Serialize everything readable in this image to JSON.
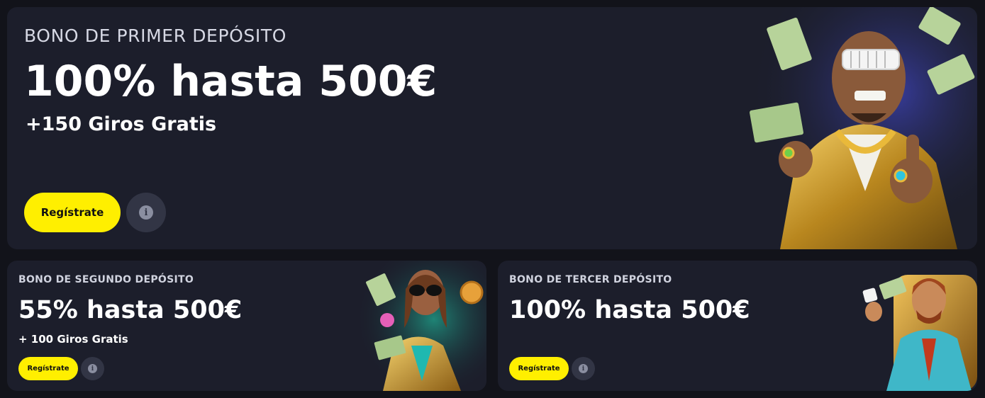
{
  "promos": {
    "first": {
      "kicker": "BONO DE PRIMER DEPÓSITO",
      "headline": "100% hasta 500€",
      "subline": "+150 Giros Gratis",
      "cta_label": "Regístrate",
      "info_icon": "info-icon"
    },
    "second": {
      "kicker": "BONO DE SEGUNDO DEPÓSITO",
      "headline": "55% hasta 500€",
      "subline": "+ 100 Giros Gratis",
      "cta_label": "Regístrate",
      "info_icon": "info-icon"
    },
    "third": {
      "kicker": "BONO DE TERCER DEPÓSITO",
      "headline": "100% hasta 500€",
      "cta_label": "Regístrate",
      "info_icon": "info-icon"
    }
  },
  "colors": {
    "page_background": "#12131a",
    "card_background": "#1c1e2b",
    "cta_background": "#ffef00",
    "cta_text": "#111111",
    "info_button": "#323545"
  }
}
